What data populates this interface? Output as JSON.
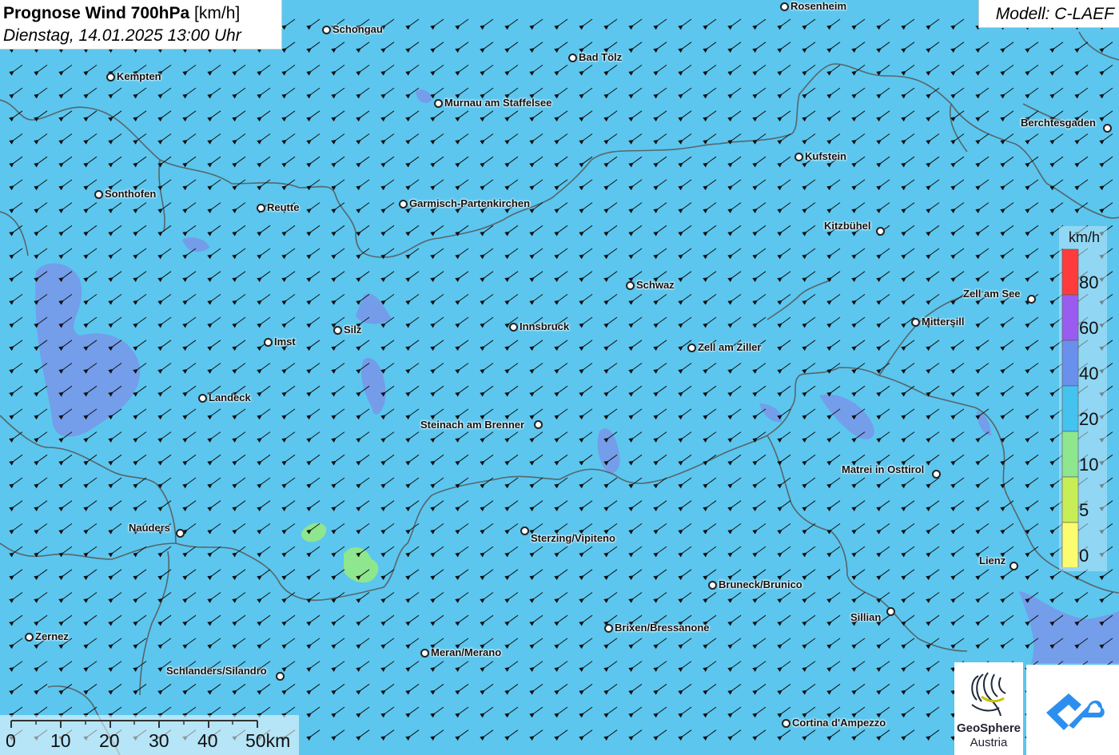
{
  "title": {
    "main": "Prognose Wind 700hPa",
    "unit": "[km/h]",
    "date": "Dienstag, 14.01.2025 13:00 Uhr"
  },
  "model": "Modell: C-LAEF",
  "legend": {
    "unit": "km/h",
    "levels": [
      {
        "label": "80",
        "color": "#ff3b3b"
      },
      {
        "label": "60",
        "color": "#9a5cf0"
      },
      {
        "label": "40",
        "color": "#6a90ee"
      },
      {
        "label": "20",
        "color": "#44c3ee"
      },
      {
        "label": "10",
        "color": "#8ee68e"
      },
      {
        "label": "5",
        "color": "#c8ee55"
      },
      {
        "label": "0",
        "color": "#fcfc70"
      }
    ]
  },
  "scale_bar": {
    "labels": [
      "0",
      "10",
      "20",
      "30",
      "40",
      "50km"
    ]
  },
  "places": [
    {
      "name": "Rosenheim"
    },
    {
      "name": "Schongau"
    },
    {
      "name": "Bad Tölz"
    },
    {
      "name": "Kempten"
    },
    {
      "name": "Murnau am Staffelsee"
    },
    {
      "name": "Berchtesgaden"
    },
    {
      "name": "Kufstein"
    },
    {
      "name": "Sonthofen"
    },
    {
      "name": "Reutte"
    },
    {
      "name": "Garmisch-Partenkirchen"
    },
    {
      "name": "Kitzbühel"
    },
    {
      "name": "Schwaz"
    },
    {
      "name": "Zell am See"
    },
    {
      "name": "Innsbruck"
    },
    {
      "name": "Silz"
    },
    {
      "name": "Mittersill"
    },
    {
      "name": "Imst"
    },
    {
      "name": "Zell am Ziller"
    },
    {
      "name": "Landeck"
    },
    {
      "name": "Steinach am Brenner"
    },
    {
      "name": "Matrei in Osttirol"
    },
    {
      "name": "Nauders"
    },
    {
      "name": "Sterzing/Vipiteno"
    },
    {
      "name": "Lienz"
    },
    {
      "name": "Bruneck/Brunico"
    },
    {
      "name": "Sillian"
    },
    {
      "name": "Zernez"
    },
    {
      "name": "Brixen/Bressanone"
    },
    {
      "name": "Meran/Merano"
    },
    {
      "name": "Schlanders/Silandro"
    },
    {
      "name": "Cortina d'Ampezzo"
    }
  ],
  "logos": {
    "geosphere_line1": "GeoSphere",
    "geosphere_line2": "Austria"
  },
  "colors": {
    "background_wind": "#5cc6ee",
    "patch_strong": "#7c8fe8",
    "patch_calm": "#8ee68e",
    "border": "#555555",
    "arrow": "#111111"
  }
}
